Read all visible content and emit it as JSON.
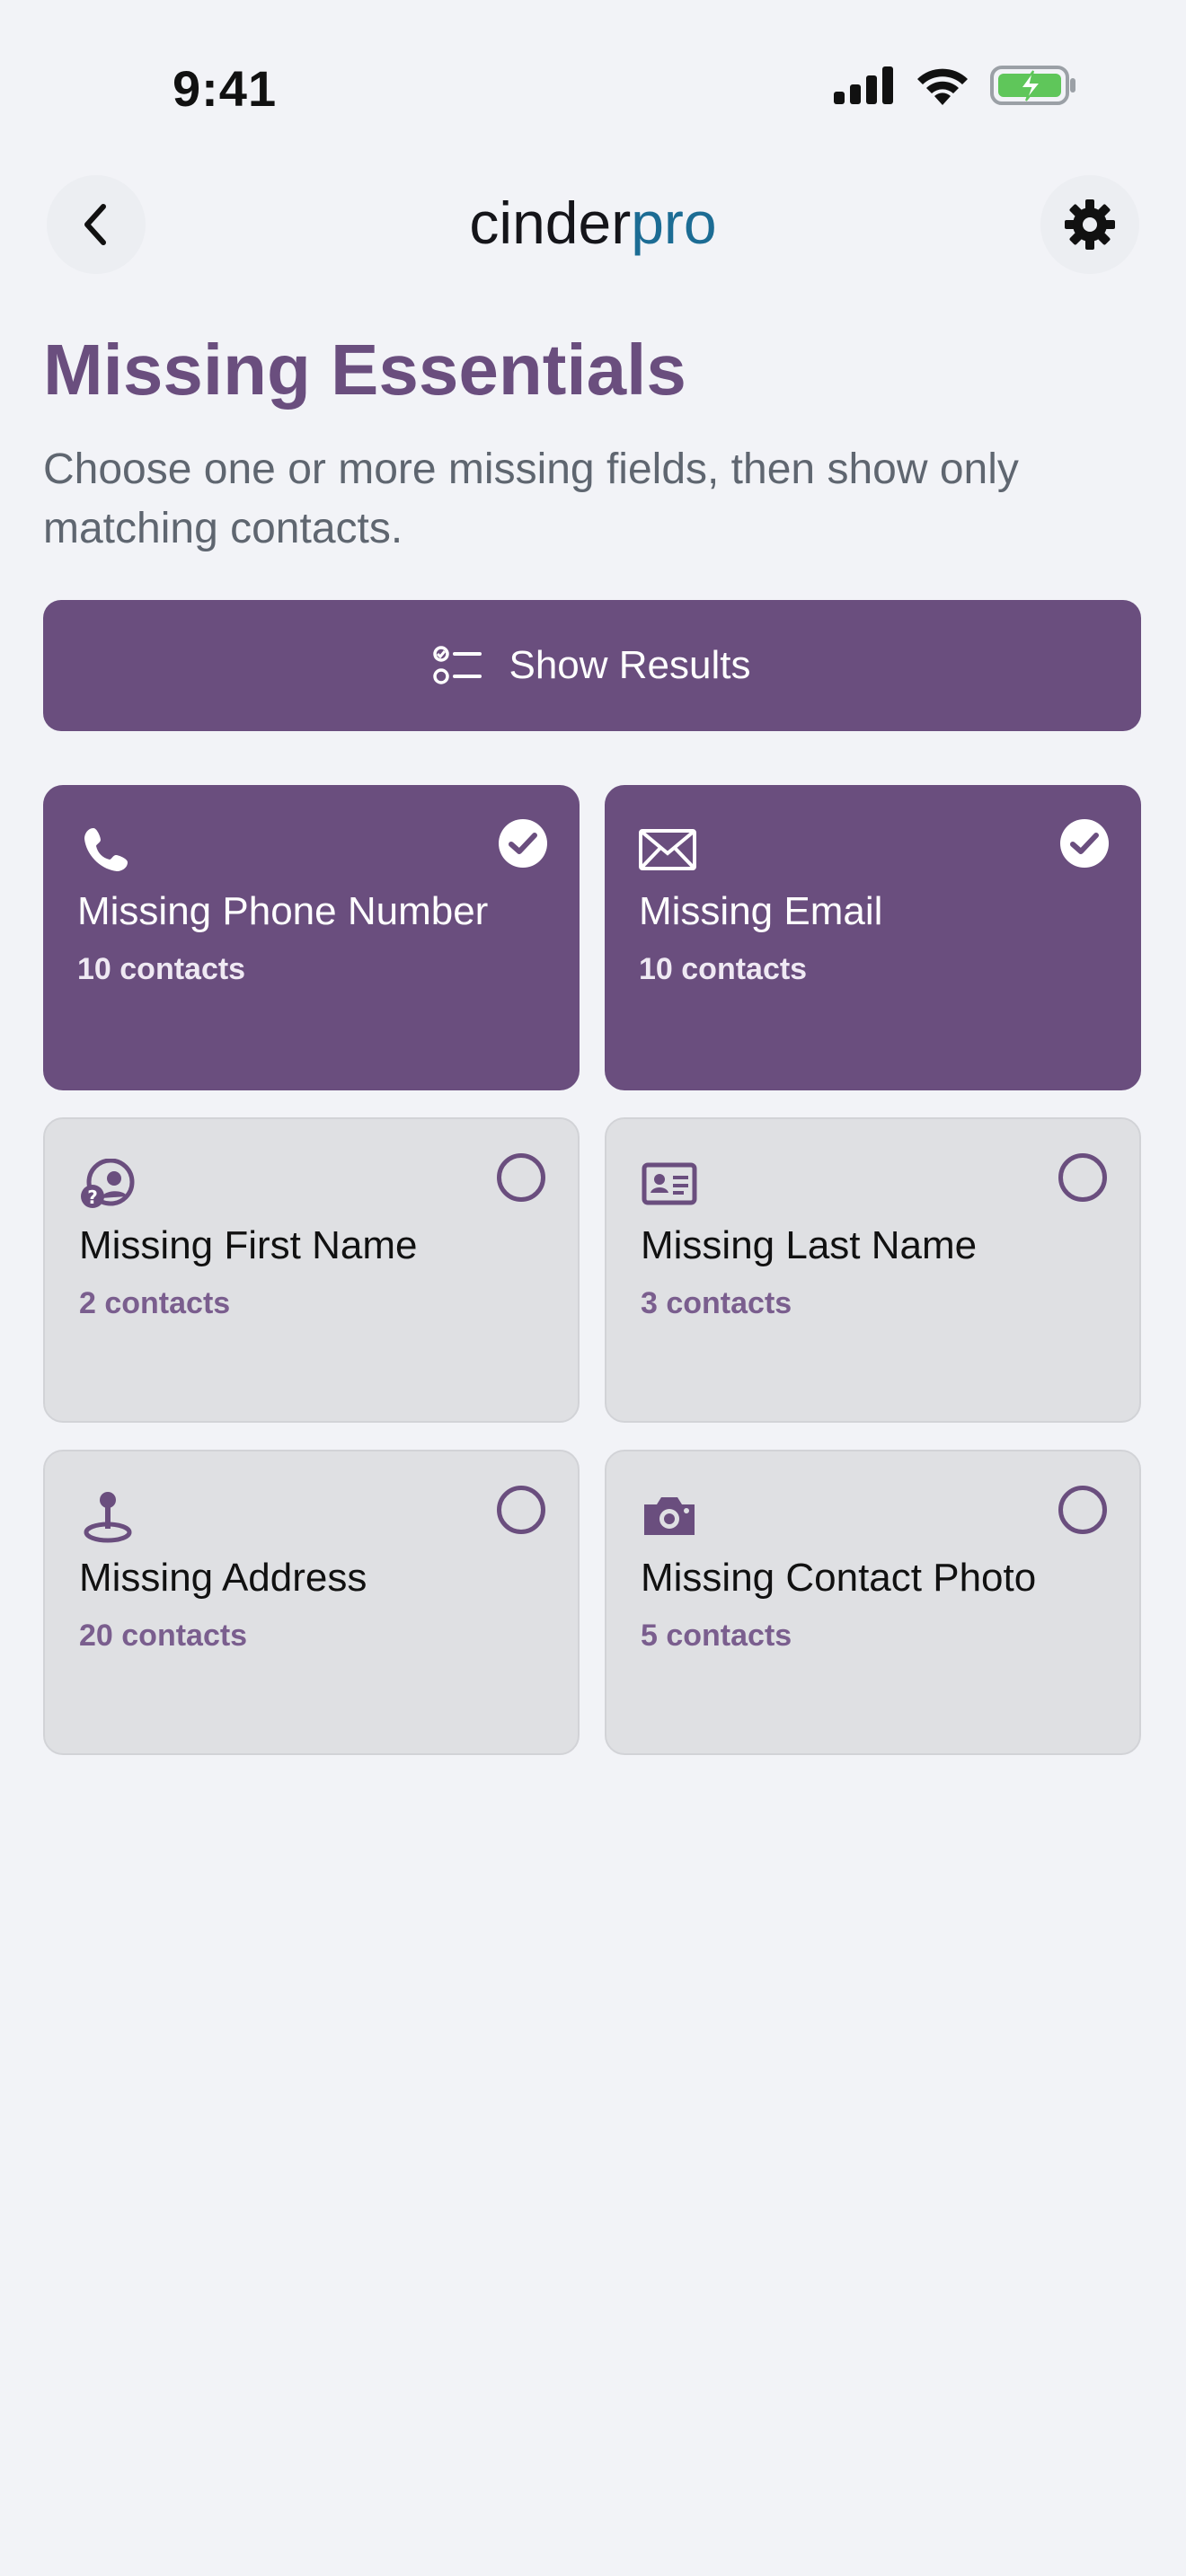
{
  "status_bar": {
    "time": "9:41"
  },
  "header": {
    "logo_part1": "cinder",
    "logo_part2": "pro",
    "back_icon": "chevron-left-icon",
    "settings_icon": "gear-icon"
  },
  "page": {
    "title": "Missing Essentials",
    "subtitle": "Choose one or more missing fields, then show only matching contacts."
  },
  "action": {
    "show_results_label": "Show Results",
    "icon": "checklist-icon"
  },
  "colors": {
    "accent": "#6a4e7e",
    "logo_blue": "#1c6c94",
    "background": "#f2f3f7",
    "card_unselected": "#dfe0e3"
  },
  "cards": [
    {
      "title": "Missing Phone Number",
      "count": "10 contacts",
      "selected": true,
      "icon": "phone-icon"
    },
    {
      "title": "Missing Email",
      "count": "10 contacts",
      "selected": true,
      "icon": "envelope-icon"
    },
    {
      "title": "Missing First Name",
      "count": "2 contacts",
      "selected": false,
      "icon": "unknown-person-icon"
    },
    {
      "title": "Missing Last Name",
      "count": "3 contacts",
      "selected": false,
      "icon": "id-card-icon"
    },
    {
      "title": "Missing Address",
      "count": "20 contacts",
      "selected": false,
      "icon": "map-pin-icon"
    },
    {
      "title": "Missing Contact Photo",
      "count": "5 contacts",
      "selected": false,
      "icon": "camera-icon"
    }
  ]
}
